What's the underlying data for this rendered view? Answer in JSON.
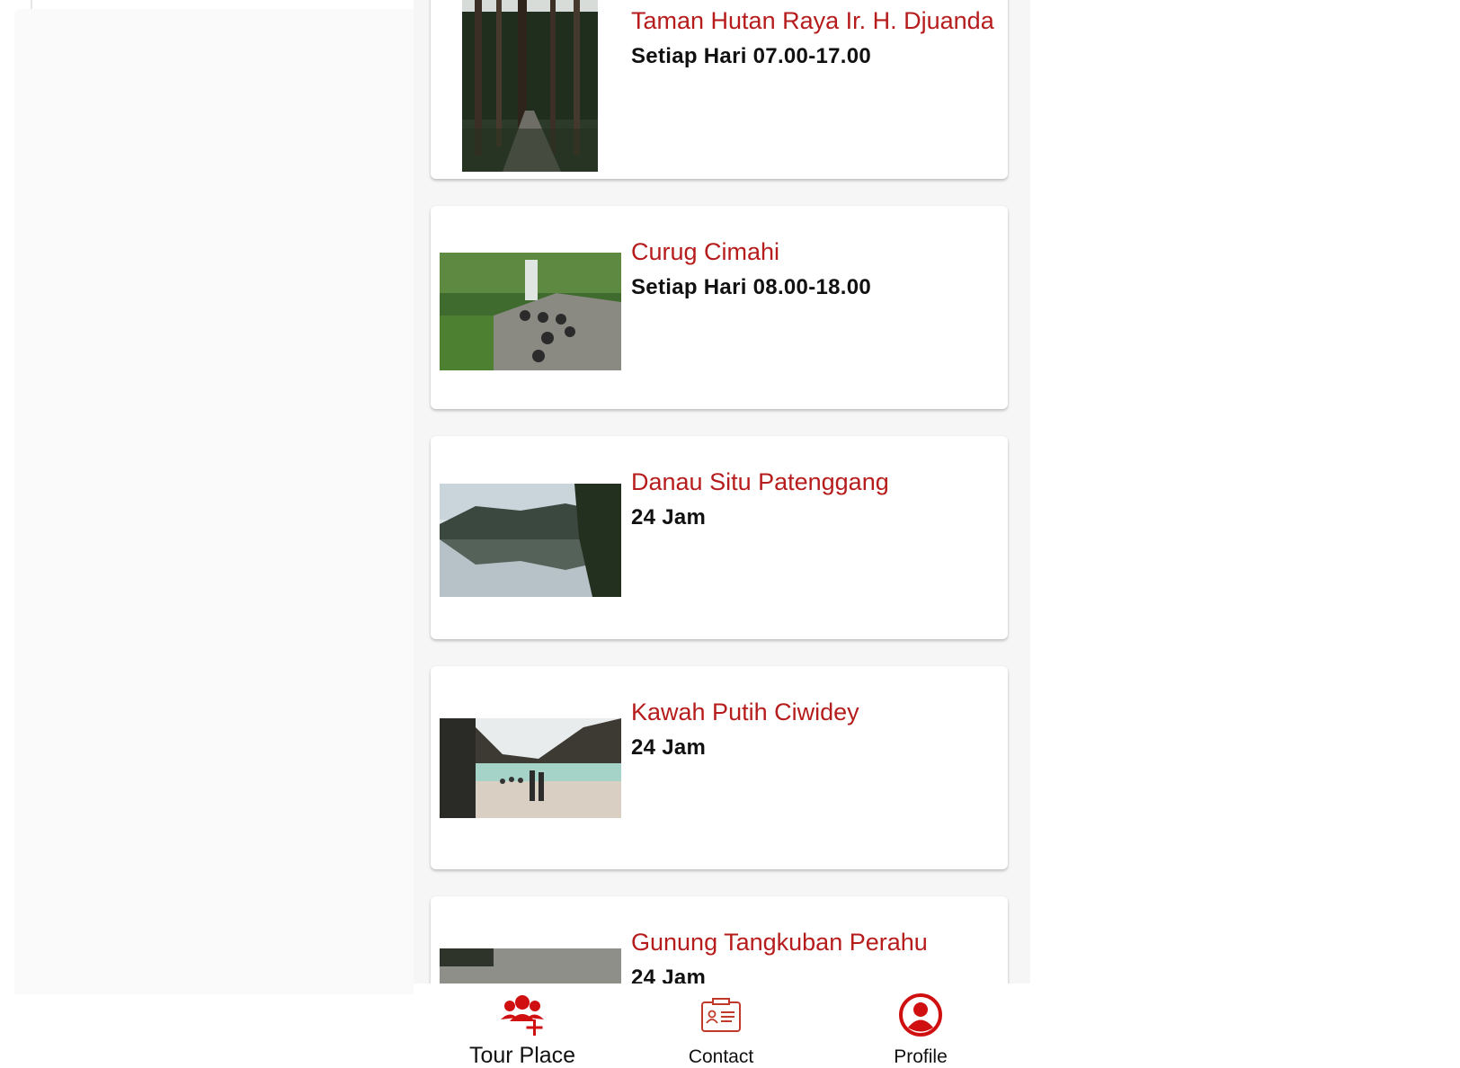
{
  "places": [
    {
      "name": "Taman Hutan Raya Ir. H. Djuanda",
      "hours": "Setiap Hari 07.00-17.00"
    },
    {
      "name": "Curug Cimahi",
      "hours": "Setiap Hari 08.00-18.00"
    },
    {
      "name": "Danau Situ Patenggang",
      "hours": "24 Jam"
    },
    {
      "name": "Kawah Putih Ciwidey",
      "hours": "24 Jam"
    },
    {
      "name": "Gunung Tangkuban Perahu",
      "hours": "24 Jam"
    }
  ],
  "bottom_nav": {
    "tour_place_label": "Tour Place",
    "contact_label": "Contact",
    "profile_label": "Profile"
  },
  "colors": {
    "accent": "#b71c1c",
    "icon_red": "#d01010"
  }
}
